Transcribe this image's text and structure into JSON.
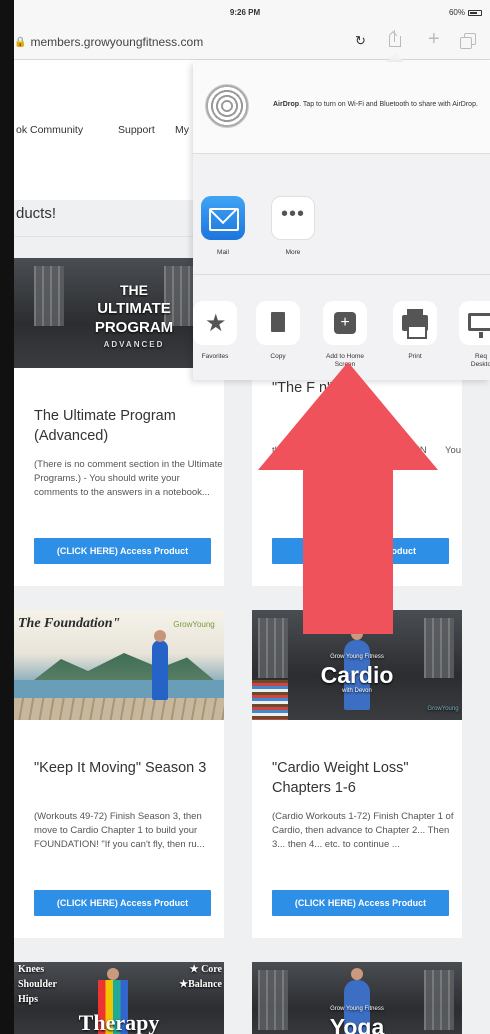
{
  "status_bar": {
    "time": "9:26 PM",
    "battery": "60%"
  },
  "address_bar": {
    "url": "members.growyoungfitness.com"
  },
  "nav": {
    "items": [
      {
        "label": "ok Community"
      },
      {
        "label": "Support"
      },
      {
        "label": "My"
      }
    ]
  },
  "section_heading": "ducts!",
  "products": [
    {
      "thumb_text_1": "THE",
      "thumb_text_2": "ULTIMATE",
      "thumb_text_3": "PROGRAM",
      "thumb_text_4": "ADVANCED",
      "title": "The Ultimate Program (Advanced)",
      "description": "(There is no comment section in the Ultimate Programs.) - You should write your comments to the answers in a notebook...",
      "button": "(CLICK HERE) Access Product"
    },
    {
      "title": "\"The F           n\" Sea",
      "description": "then move        2 to build your FOUN       You don't just wake up on        d b...",
      "button": "(CLICK H          ss Product"
    },
    {
      "thumb_text_1": "The Foundation\"",
      "thumb_text_2": "GrowYoung",
      "title": "\"Keep It Moving\" Season 3",
      "description": "(Workouts 49-72) Finish Season 3, then move to Cardio Chapter 1 to build your FOUNDATION! \"If you can't fly, then ru...",
      "button": "(CLICK HERE) Access Product"
    },
    {
      "thumb_text_1": "Grow Young Fitness",
      "thumb_text_2": "Cardio",
      "thumb_text_3": "with Devon",
      "thumb_text_4": "GrowYoung",
      "title": "\"Cardio Weight Loss\" Chapters 1-6",
      "description": "(Cardio Workouts 1-72) Finish Chapter 1 of Cardio, then advance to Chapter 2... Then 3... then 4... etc. to continue ...",
      "button": "(CLICK HERE) Access Product"
    },
    {
      "thumb_text_1": "Knees",
      "thumb_text_2": "Shoulder",
      "thumb_text_3": "Hips",
      "thumb_text_4": "★ Core",
      "thumb_text_5": "★Balance",
      "thumb_text_6": "Therapy"
    },
    {
      "thumb_text_1": "Grow Young Fitness",
      "thumb_text_2": "Yoga"
    }
  ],
  "share_sheet": {
    "airdrop_title": "AirDrop",
    "airdrop_text": ". Tap to turn on Wi-Fi and Bluetooth to share with AirDrop.",
    "apps": [
      {
        "label": "Mail",
        "icon": "mail-icon"
      },
      {
        "label": "More",
        "icon": "more-icon",
        "glyph": "•••"
      }
    ],
    "actions": [
      {
        "label": "Favorites",
        "icon": "star-icon"
      },
      {
        "label": "Copy",
        "icon": "copy-icon"
      },
      {
        "label": "Add to Home Screen",
        "icon": "add-to-home-screen-icon",
        "glyph": "+"
      },
      {
        "label": "Print",
        "icon": "print-icon"
      },
      {
        "label": "Req Deskto",
        "icon": "request-desktop-icon"
      }
    ]
  },
  "colors": {
    "accent_button": "#2d8fe6",
    "arrow": "#f0525c",
    "mail_blue": "#1d75dd"
  }
}
